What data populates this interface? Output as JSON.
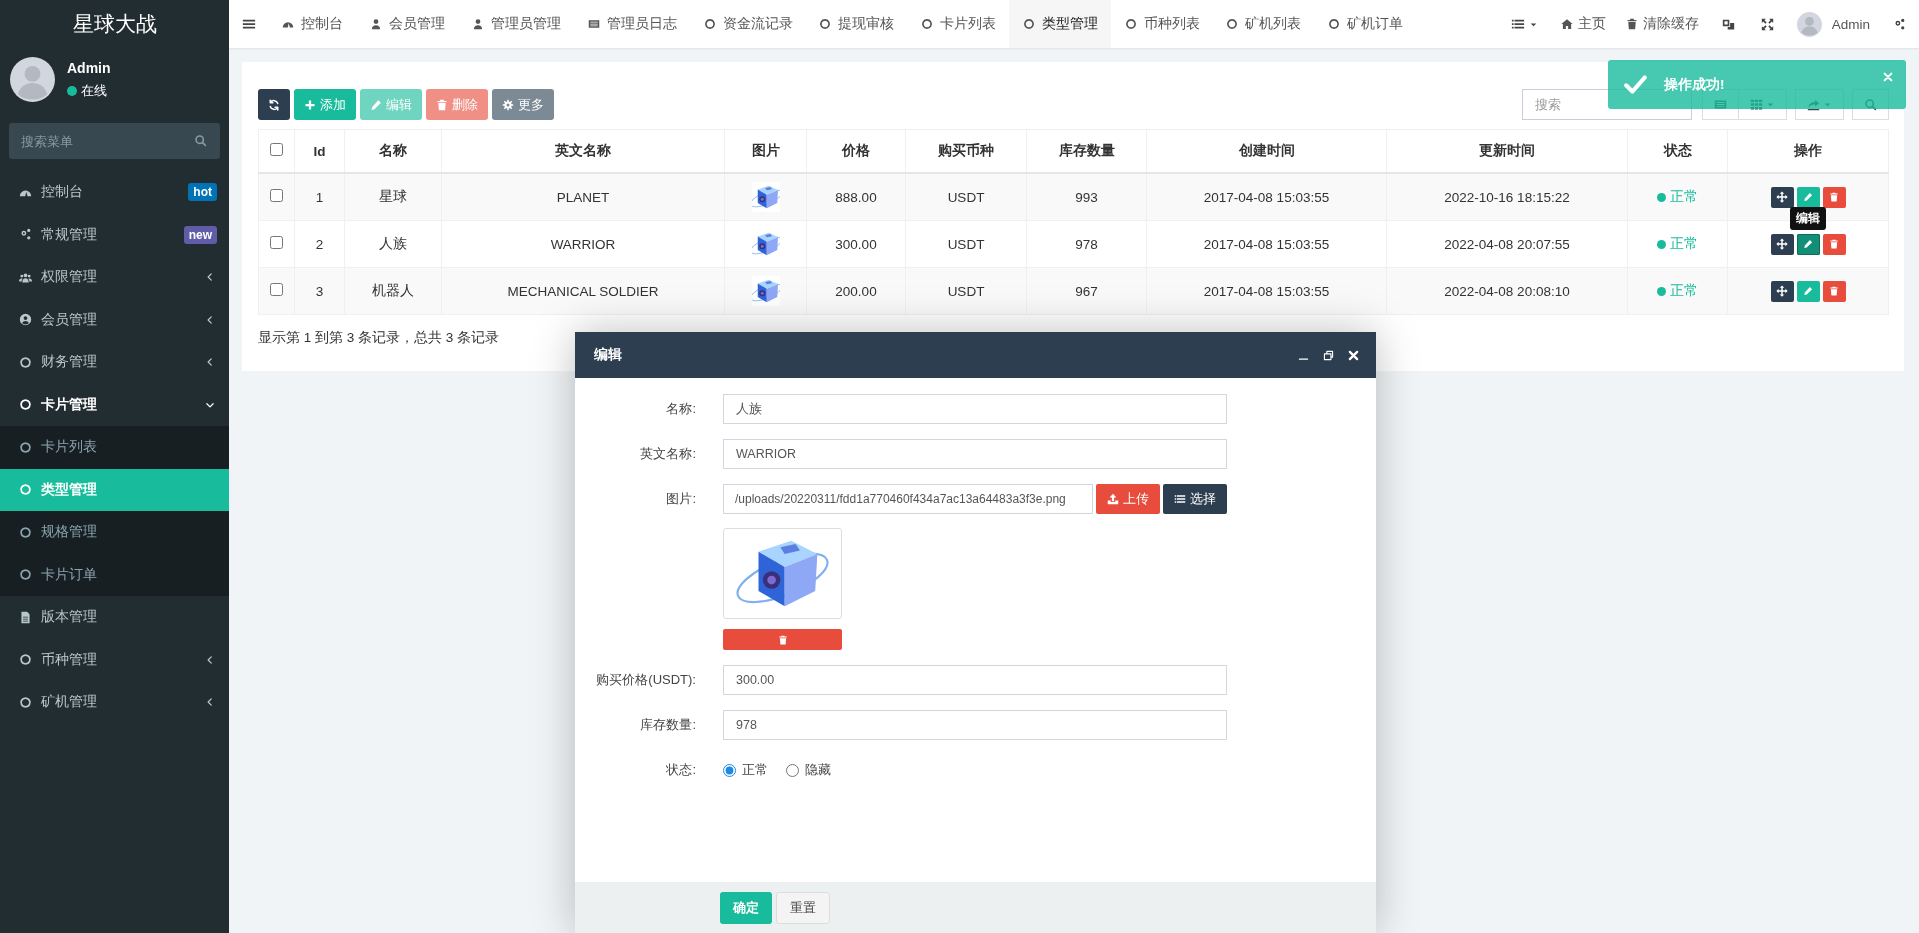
{
  "logo": "星球大战",
  "user": {
    "name": "Admin",
    "status": "在线"
  },
  "sidebar": {
    "search_placeholder": "搜索菜单",
    "items": [
      {
        "label": "控制台",
        "kind": "link",
        "selected": false,
        "expanded": false,
        "badge": {
          "text": "hot",
          "color": "#0073b7"
        }
      },
      {
        "label": "常规管理",
        "kind": "link",
        "selected": false,
        "expanded": false,
        "badge": {
          "text": "new",
          "color": "#605ca8"
        }
      },
      {
        "label": "权限管理",
        "kind": "group",
        "selected": false,
        "expanded": false
      },
      {
        "label": "会员管理",
        "kind": "group",
        "selected": false,
        "expanded": false
      },
      {
        "label": "财务管理",
        "kind": "group",
        "selected": false,
        "expanded": false
      },
      {
        "label": "卡片管理",
        "kind": "group",
        "selected": false,
        "expanded": true,
        "children": [
          {
            "label": "卡片列表",
            "selected": false
          },
          {
            "label": "类型管理",
            "selected": true
          },
          {
            "label": "规格管理",
            "selected": false
          },
          {
            "label": "卡片订单",
            "selected": false
          }
        ]
      },
      {
        "label": "版本管理",
        "kind": "link",
        "selected": false,
        "expanded": false
      },
      {
        "label": "币种管理",
        "kind": "group",
        "selected": false,
        "expanded": false
      },
      {
        "label": "矿机管理",
        "kind": "group",
        "selected": false,
        "expanded": false
      }
    ]
  },
  "topnav": {
    "tabs": [
      {
        "label": "控制台",
        "selected": false
      },
      {
        "label": "会员管理",
        "selected": false
      },
      {
        "label": "管理员管理",
        "selected": false
      },
      {
        "label": "管理员日志",
        "selected": false
      },
      {
        "label": "资金流记录",
        "selected": false
      },
      {
        "label": "提现审核",
        "selected": false
      },
      {
        "label": "卡片列表",
        "selected": false
      },
      {
        "label": "类型管理",
        "selected": true
      },
      {
        "label": "币种列表",
        "selected": false
      },
      {
        "label": "矿机列表",
        "selected": false
      },
      {
        "label": "矿机订单",
        "selected": false
      }
    ],
    "links": [
      "主页",
      "清除缓存"
    ],
    "user": "Admin"
  },
  "toolbar": {
    "buttons": [
      {
        "kind": "refresh",
        "disabled": false
      },
      {
        "kind": "add",
        "label": "添加",
        "disabled": false
      },
      {
        "kind": "edit",
        "label": "编辑",
        "disabled": true
      },
      {
        "kind": "delete",
        "label": "删除",
        "disabled": true
      },
      {
        "kind": "more",
        "label": "更多",
        "disabled": false
      }
    ],
    "search_placeholder": "搜索"
  },
  "table": {
    "all_checked": false,
    "columns": [
      "Id",
      "名称",
      "英文名称",
      "图片",
      "价格",
      "购买币种",
      "库存数量",
      "创建时间",
      "更新时间",
      "状态",
      "操作"
    ],
    "rows": [
      {
        "checked": false,
        "id": "1",
        "name": "星球",
        "english_name": "PLANET",
        "price": "888.00",
        "currency": "USDT",
        "stock": "993",
        "created": "2017-04-08 15:03:55",
        "updated": "2022-10-16 18:15:22",
        "status": "正常"
      },
      {
        "checked": false,
        "id": "2",
        "name": "人族",
        "english_name": "WARRIOR",
        "price": "300.00",
        "currency": "USDT",
        "stock": "978",
        "created": "2017-04-08 15:03:55",
        "updated": "2022-04-08 20:07:55",
        "status": "正常",
        "tooltip": "编辑"
      },
      {
        "checked": false,
        "id": "3",
        "name": "机器人",
        "english_name": "MECHANICAL SOLDIER",
        "price": "200.00",
        "currency": "USDT",
        "stock": "967",
        "created": "2017-04-08 15:03:55",
        "updated": "2022-04-08 20:08:10",
        "status": "正常"
      }
    ],
    "summary": "显示第 1 到第 3 条记录，总共 3 条记录"
  },
  "toast": {
    "message": "操作成功!"
  },
  "dialog": {
    "title": "编辑",
    "fields": [
      {
        "kind": "text",
        "label": "名称:",
        "value": "人族"
      },
      {
        "kind": "text",
        "label": "英文名称:",
        "value": "WARRIOR"
      },
      {
        "label": "图片:",
        "value": "/uploads/20220311/fdd1a770460f434a7ac13a64483a3f3e.png",
        "upload": "上传",
        "choose": "选择"
      },
      {
        "kind": "text",
        "label": "购买价格(USDT):",
        "value": "300.00"
      },
      {
        "kind": "text",
        "label": "库存数量:",
        "value": "978"
      },
      {
        "kind": "radio",
        "label": "状态:",
        "options": [
          {
            "label": "正常",
            "selected": true
          },
          {
            "label": "隐藏",
            "selected": false
          }
        ]
      }
    ],
    "buttons": [
      {
        "kind": "primary",
        "label": "确定"
      },
      {
        "kind": "default",
        "label": "重置"
      }
    ]
  }
}
